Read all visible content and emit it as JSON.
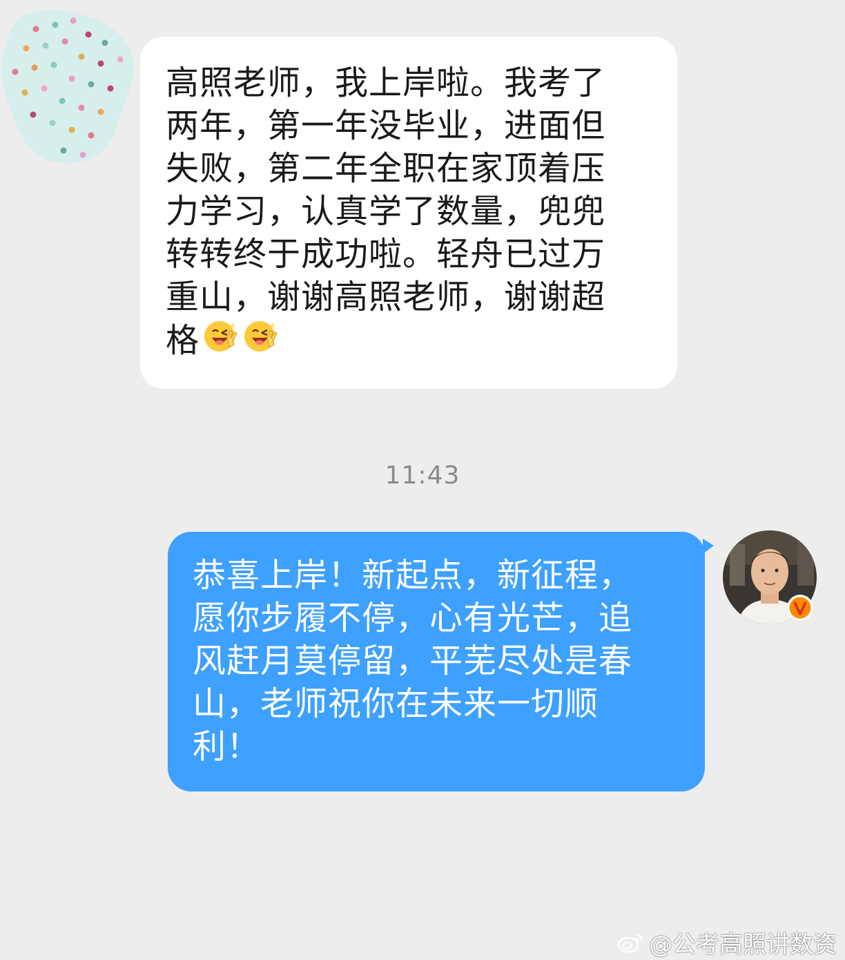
{
  "incoming": {
    "lines": [
      "高照老师，我上岸啦。我考了",
      "两年，第一年没毕业，进面但",
      "失败，第二年全职在家顶着压",
      "力学习，认真学了数量，兜兜",
      "转转终于成功啦。轻舟已过万",
      "重山，谢谢高照老师，谢谢超",
      "格"
    ],
    "emojis": [
      "grin-wink-v-icon",
      "grin-wink-v-icon"
    ]
  },
  "timestamp": "11:43",
  "outgoing": {
    "lines": [
      "恭喜上岸！新起点，新征程，",
      "愿你步履不停，心有光芒，追",
      "风赶月莫停留，平芜尽处是春",
      "山，老师祝你在未来一切顺",
      "利！"
    ]
  },
  "watermark": {
    "text": "@公考高照讲数资",
    "icon": "weibo-icon"
  },
  "colors": {
    "background": "#ededed",
    "incoming_bubble": "#ffffff",
    "outgoing_bubble": "#3ea0ff",
    "verified_badge": "#ff8a00"
  }
}
